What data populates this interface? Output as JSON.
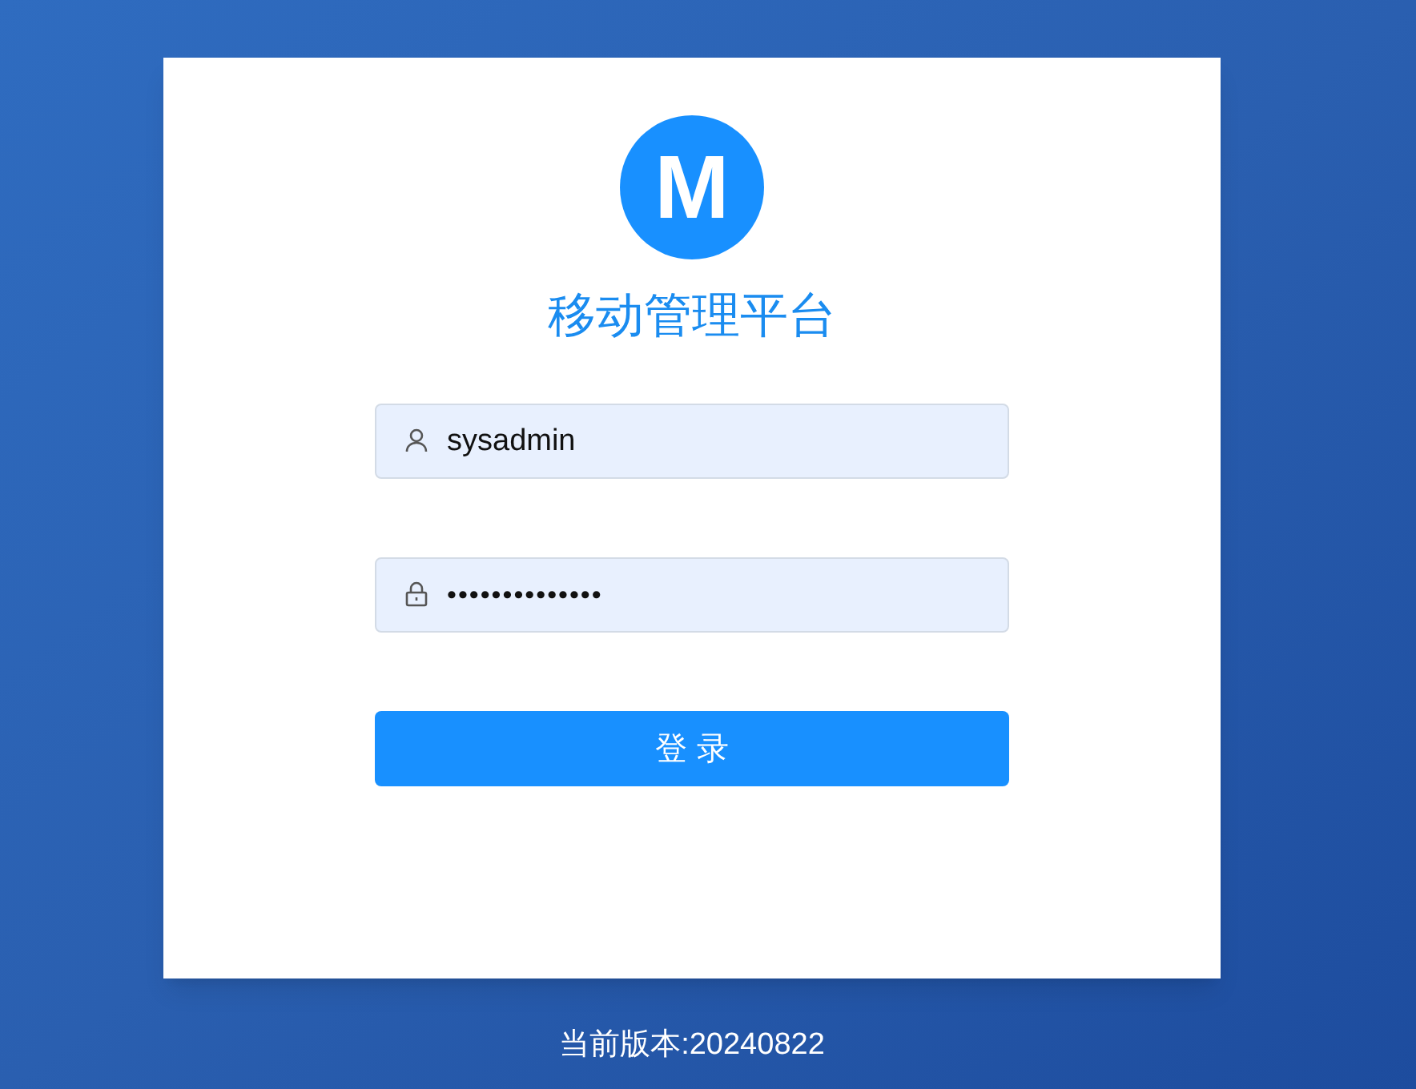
{
  "logo": {
    "letter": "M"
  },
  "title": "移动管理平台",
  "username": {
    "value": "sysadmin"
  },
  "password": {
    "value": "••••••••••••••"
  },
  "login_button": "登 录",
  "version": "当前版本:20240822"
}
